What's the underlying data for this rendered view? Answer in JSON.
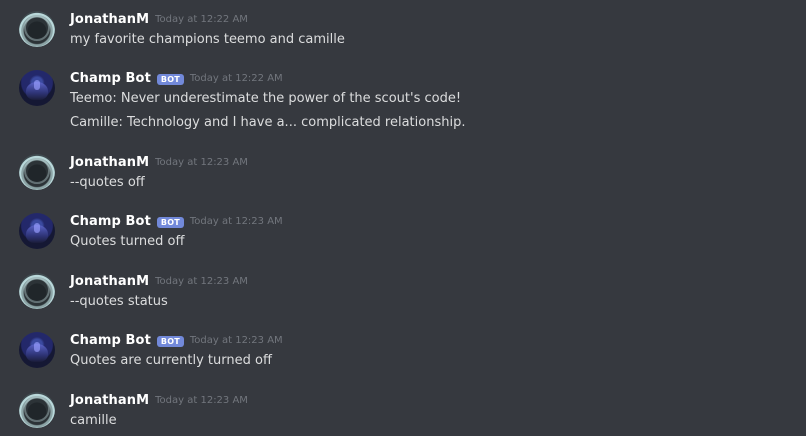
{
  "messages": [
    {
      "author": "JonathanM",
      "is_bot": false,
      "timestamp": "Today at 12:22 AM",
      "lines": [
        "my favorite champions teemo and camille"
      ]
    },
    {
      "author": "Champ Bot",
      "is_bot": true,
      "badge": "BOT",
      "timestamp": "Today at 12:22 AM",
      "lines": [
        "Teemo: Never underestimate the power of the scout's code!",
        "Camille: Technology and I have a... complicated relationship."
      ]
    },
    {
      "author": "JonathanM",
      "is_bot": false,
      "timestamp": "Today at 12:23 AM",
      "lines": [
        "--quotes off"
      ]
    },
    {
      "author": "Champ Bot",
      "is_bot": true,
      "badge": "BOT",
      "timestamp": "Today at 12:23 AM",
      "lines": [
        "Quotes turned off"
      ]
    },
    {
      "author": "JonathanM",
      "is_bot": false,
      "timestamp": "Today at 12:23 AM",
      "lines": [
        "--quotes status"
      ]
    },
    {
      "author": "Champ Bot",
      "is_bot": true,
      "badge": "BOT",
      "timestamp": "Today at 12:23 AM",
      "lines": [
        "Quotes are currently turned off"
      ]
    },
    {
      "author": "JonathanM",
      "is_bot": false,
      "timestamp": "Today at 12:23 AM",
      "lines": [
        "camille"
      ]
    }
  ],
  "colors": {
    "background": "#36393f",
    "username": "#ffffff",
    "message_text": "#dcddde",
    "timestamp": "#72767d",
    "bot_badge": "#7289da"
  }
}
